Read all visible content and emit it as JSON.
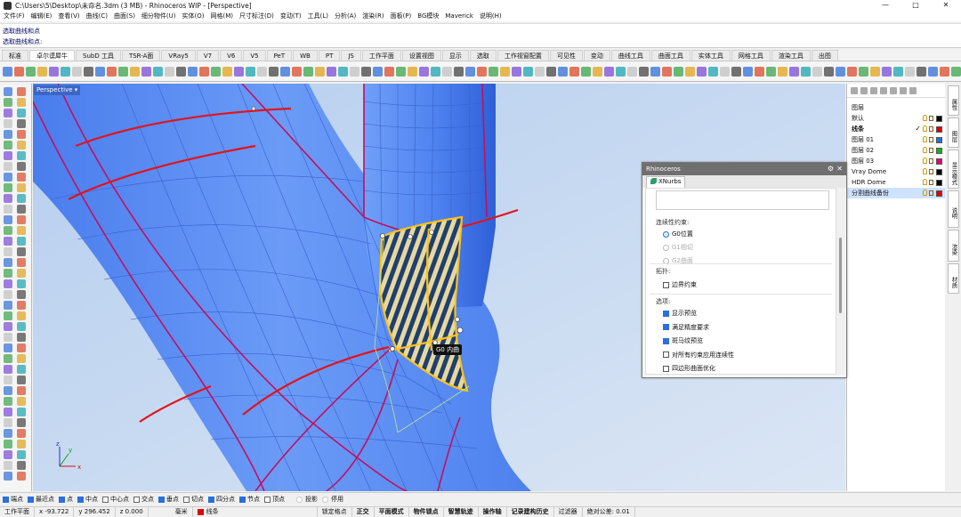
{
  "window": {
    "title": "C:\\Users\\5\\Desktop\\未命名.3dm (3 MB) - Rhinoceros WIP - [Perspective]",
    "controls": [
      "—",
      "□",
      "✕"
    ]
  },
  "menu": [
    "文件(F)",
    "编辑(E)",
    "查看(V)",
    "曲线(C)",
    "曲面(S)",
    "细分物件(U)",
    "实体(O)",
    "网格(M)",
    "尺寸标注(D)",
    "变动(T)",
    "工具(L)",
    "分析(A)",
    "渲染(R)",
    "面板(P)",
    "BG模块",
    "Maverick",
    "说明(H)"
  ],
  "command_history": [
    "选取曲线和点",
    "选取曲线和点:"
  ],
  "tabs": [
    "标准",
    "卓尔谟犀牛",
    "SubD 工具",
    "TSR-A面",
    "VRay5",
    "V7",
    "V6",
    "V5",
    "PeT",
    "WB",
    "PT",
    "JS",
    "工作平面",
    "设置视图",
    "显示",
    "选取",
    "工作视窗配置",
    "可见性",
    "变动",
    "曲线工具",
    "曲面工具",
    "实体工具",
    "网格工具",
    "渲染工具",
    "出图"
  ],
  "active_tab": "卓尔谟犀牛",
  "viewport": {
    "label": "Perspective",
    "axis_x": "x",
    "axis_y": "y",
    "axis_z": "z",
    "tag": "G0 内曲"
  },
  "layers_panel": {
    "header": "图层",
    "layers": [
      {
        "name": "默认",
        "color": "#000000",
        "check": ""
      },
      {
        "name": "线条",
        "color": "#e00000",
        "check": "✓",
        "bold": true
      },
      {
        "name": "图层 01",
        "color": "#1e73d9",
        "check": ""
      },
      {
        "name": "图层 02",
        "color": "#18b018",
        "check": ""
      },
      {
        "name": "图层 03",
        "color": "#e0007a",
        "check": ""
      },
      {
        "name": "Vray Dome",
        "color": "#000000",
        "check": ""
      },
      {
        "name": "HDR Dome",
        "color": "#000000",
        "check": ""
      },
      {
        "name": "分割曲线备份",
        "color": "#e00000",
        "check": "",
        "selected": true
      }
    ]
  },
  "side_tabs": [
    "属性",
    "图层",
    "显示模式",
    "说明",
    "渲染",
    "材质"
  ],
  "dialog": {
    "title": "Rhinoceros",
    "tab": "XNurbs",
    "continuity_label": "连续性约束:",
    "continuity_options": [
      {
        "label": "G0位置",
        "selected": true,
        "enabled": true
      },
      {
        "label": "G1相切",
        "selected": false,
        "enabled": false
      },
      {
        "label": "G2曲面",
        "selected": false,
        "enabled": false
      }
    ],
    "topology_label": "拓扑:",
    "topology_options": [
      {
        "label": "边界约束",
        "checked": false
      }
    ],
    "options_label": "选项:",
    "options": [
      {
        "label": "显示预览",
        "checked": true
      },
      {
        "label": "满足精度要求",
        "checked": true
      },
      {
        "label": "斑马纹预览",
        "checked": true
      },
      {
        "label": "对所有约束应用连续性",
        "checked": false
      },
      {
        "label": "四边形曲面优化",
        "checked": false
      }
    ]
  },
  "osnaps": [
    {
      "label": "端点",
      "on": true
    },
    {
      "label": "最近点",
      "on": true
    },
    {
      "label": "点",
      "on": true
    },
    {
      "label": "中点",
      "on": true
    },
    {
      "label": "中心点",
      "on": false
    },
    {
      "label": "交点",
      "on": false
    },
    {
      "label": "垂点",
      "on": true
    },
    {
      "label": "切点",
      "on": false
    },
    {
      "label": "四分点",
      "on": true
    },
    {
      "label": "节点",
      "on": true
    },
    {
      "label": "顶点",
      "on": false
    },
    {
      "label": "投影",
      "on": false
    },
    {
      "label": "停用",
      "on": false
    }
  ],
  "status": {
    "plane": "工作平面",
    "x": "x -93.722",
    "y": "y 296.452",
    "z": "z 0.000",
    "units": "毫米",
    "layer": "线条",
    "toggles": [
      "锁定格点",
      "正交",
      "平面模式",
      "物件锁点",
      "智慧轨迹",
      "操作轴",
      "记录建构历史",
      "过滤器"
    ],
    "tolerance": "绝对公差: 0.01"
  },
  "colors": {
    "surface": "#5b8ef2",
    "isoline": "#c01060",
    "boundary": "#e0141e",
    "highlight": "#ffc21a"
  }
}
